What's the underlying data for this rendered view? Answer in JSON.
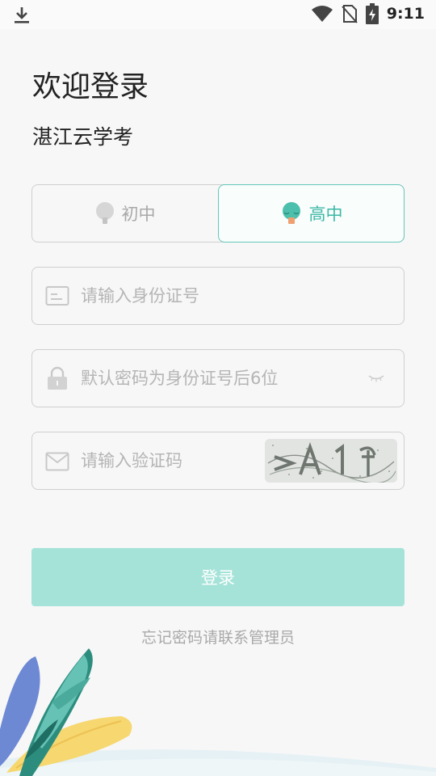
{
  "status_bar": {
    "time": "9:11",
    "icons": [
      "download-icon",
      "wifi-icon",
      "no-sim-icon",
      "battery-charging-icon"
    ]
  },
  "header": {
    "title": "欢迎登录",
    "subtitle": "湛江云学考"
  },
  "level_toggle": {
    "options": [
      {
        "label": "初中",
        "icon": "tree-icon",
        "selected": false
      },
      {
        "label": "高中",
        "icon": "tree-icon",
        "selected": true
      }
    ]
  },
  "form": {
    "id_placeholder": "请输入身份证号",
    "id_value": "",
    "password_placeholder": "默认密码为身份证号后6位",
    "password_value": "",
    "captcha_placeholder": "请输入验证码",
    "captcha_value": ""
  },
  "login_label": "登录",
  "forgot_text": "忘记密码请联系管理员",
  "colors": {
    "accent": "#3cb8a6",
    "button_bg": "#a5e3d9",
    "background": "#f7f7f7",
    "border": "#cfcfcf",
    "placeholder": "#b5b5b5"
  }
}
